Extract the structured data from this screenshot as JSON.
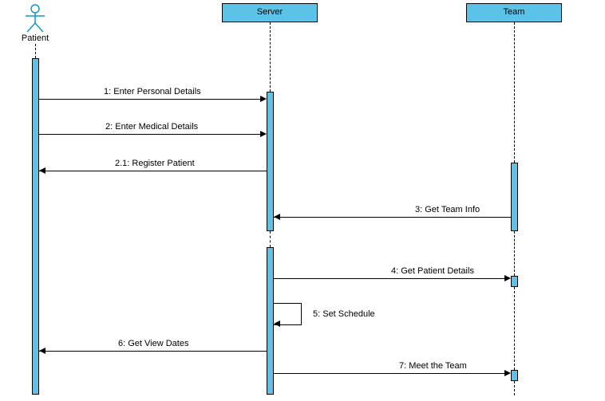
{
  "actors": {
    "patient": {
      "label": "Patient"
    },
    "server": {
      "label": "Server"
    },
    "team": {
      "label": "Team"
    }
  },
  "messages": {
    "m1": "1: Enter Personal Details",
    "m2": "2: Enter Medical Details",
    "m21": "2.1: Register Patient",
    "m3": "3: Get Team Info",
    "m4": "4: Get Patient Details",
    "m5": "5: Set Schedule",
    "m6": "6: Get View Dates",
    "m7": "7: Meet the Team"
  },
  "chart_data": {
    "type": "sequence-diagram",
    "lifelines": [
      {
        "id": "patient",
        "kind": "actor",
        "label": "Patient"
      },
      {
        "id": "server",
        "kind": "object",
        "label": "Server"
      },
      {
        "id": "team",
        "kind": "object",
        "label": "Team"
      }
    ],
    "messages": [
      {
        "seq": "1",
        "from": "patient",
        "to": "server",
        "label": "Enter Personal Details"
      },
      {
        "seq": "2",
        "from": "patient",
        "to": "server",
        "label": "Enter Medical Details"
      },
      {
        "seq": "2.1",
        "from": "server",
        "to": "patient",
        "label": "Register Patient"
      },
      {
        "seq": "3",
        "from": "team",
        "to": "server",
        "label": "Get Team Info"
      },
      {
        "seq": "4",
        "from": "server",
        "to": "team",
        "label": "Get Patient Details"
      },
      {
        "seq": "5",
        "from": "server",
        "to": "server",
        "label": "Set Schedule",
        "self": true
      },
      {
        "seq": "6",
        "from": "server",
        "to": "patient",
        "label": "Get View Dates"
      },
      {
        "seq": "7",
        "from": "server",
        "to": "team",
        "label": "Meet the Team"
      }
    ]
  }
}
